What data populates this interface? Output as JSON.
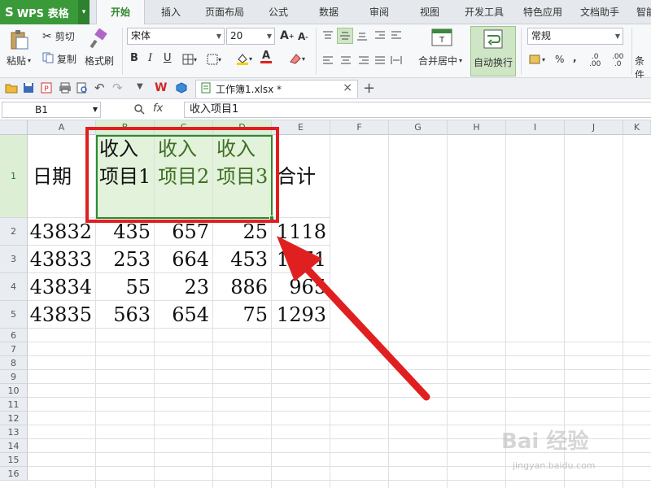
{
  "app": {
    "logo": "WPS 表格"
  },
  "menu": {
    "tabs": [
      "开始",
      "插入",
      "页面布局",
      "公式",
      "数据",
      "审阅",
      "视图",
      "开发工具",
      "特色应用",
      "文档助手",
      "智能"
    ]
  },
  "ribbon": {
    "paste": "粘贴",
    "cut": "剪切",
    "copy": "复制",
    "format_painter": "格式刷",
    "font_name": "宋体",
    "font_size": "20",
    "bold": "B",
    "italic": "I",
    "underline": "U",
    "font_color_letter": "A",
    "merge_center": "合并居中",
    "wrap_text": "自动换行",
    "number_format": "常规",
    "percent": "%",
    "comma": ",",
    "dec_inc": ".00",
    "dec_dec": ".0",
    "conditional": "条件"
  },
  "quick": {
    "doc_tab": "工作簿1.xlsx *",
    "close": "×",
    "new_tab": "+"
  },
  "formula_bar": {
    "name_box": "B1",
    "fx": "fx",
    "content": "收入项目1"
  },
  "sheet": {
    "columns": [
      "A",
      "B",
      "C",
      "D",
      "E",
      "F",
      "G",
      "H",
      "I",
      "J",
      "K"
    ],
    "rows": [
      "1",
      "2",
      "3",
      "4",
      "5",
      "6",
      "7",
      "8",
      "9",
      "10",
      "11",
      "12",
      "13",
      "14",
      "15",
      "16"
    ],
    "header_row": [
      "日期",
      "收入项目1",
      "收入项目2",
      "收入项目3",
      "合计"
    ],
    "data": [
      [
        "43832",
        "435",
        "657",
        "25",
        "1118"
      ],
      [
        "43833",
        "253",
        "664",
        "453",
        "1371"
      ],
      [
        "43834",
        "55",
        "23",
        "886",
        "965"
      ],
      [
        "43835",
        "563",
        "654",
        "75",
        "1293"
      ]
    ]
  },
  "watermark": {
    "brand": "Bai 经验",
    "url": "jingyan.baidu.com"
  },
  "colors": {
    "accent": "#2c8a2c",
    "selection_fill": "#e3f2da",
    "annotation": "#e02020"
  }
}
